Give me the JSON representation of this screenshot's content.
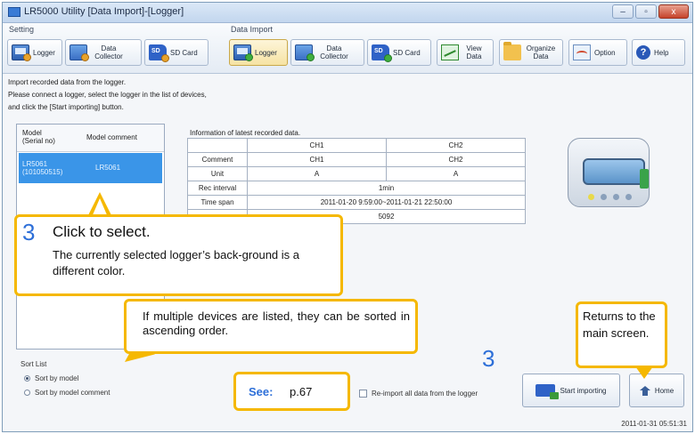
{
  "window": {
    "title": "LR5000 Utility [Data Import]-[Logger]",
    "minimize_label": "–",
    "maximize_label": "▫",
    "close_label": "x"
  },
  "ribbon": {
    "setting_group": "Setting",
    "import_group": "Data Import",
    "setting_buttons": [
      {
        "label": "Logger",
        "icon": "logger-icon"
      },
      {
        "label": "Data Collector",
        "icon": "data-collector-icon"
      },
      {
        "label": "SD Card",
        "icon": "sd-card-icon"
      }
    ],
    "import_buttons": [
      {
        "label": "Logger",
        "icon": "logger-icon"
      },
      {
        "label": "Data Collector",
        "icon": "data-collector-icon"
      },
      {
        "label": "SD Card",
        "icon": "sd-card-icon"
      }
    ],
    "view_data": "View Data",
    "organize_data": "Organize Data",
    "option": "Option",
    "help": "Help"
  },
  "instructions": [
    "Import recorded data from the logger.",
    "Please connect a logger, select the logger in the list of devices,",
    "and click the [Start importing] button."
  ],
  "device_list": {
    "col_model": "Model",
    "col_serial": "(Serial no)",
    "col_comment": "Model comment",
    "rows": [
      {
        "model": "LR5061",
        "serial": "(101050515)",
        "comment": "LR5061"
      }
    ]
  },
  "sort": {
    "title": "Sort List",
    "options": [
      "Sort by model",
      "Sort by model comment"
    ],
    "selected": "Sort by model"
  },
  "info": {
    "title": "Information of latest recorded data.",
    "ch1": "CH1",
    "ch2": "CH2",
    "rows": {
      "comment_label": "Comment",
      "comment_ch1": "CH1",
      "comment_ch2": "CH2",
      "unit_label": "Unit",
      "unit_ch1": "A",
      "unit_ch2": "A",
      "rec_interval_label": "Rec interval",
      "rec_interval": "1min",
      "time_span_label": "Time span",
      "time_span": "2011-01-20 9:59:00~2011-01-21 22:50:00",
      "count": "5092"
    }
  },
  "reimport_label": "Re-import all data from the logger",
  "start_importing": "Start importing",
  "home": "Home",
  "status_time": "2011-01-31 05:51:31",
  "callouts": {
    "select_num": "3",
    "select_head": "Click to select.",
    "select_body": "The currently selected logger’s back-ground is a different color.",
    "sort_note": "If multiple devices are listed, they can be sorted in ascending order.",
    "home_note": "Returns to the main screen.",
    "see_label": "See:",
    "see_ref": "p.67",
    "step_num": "3"
  }
}
